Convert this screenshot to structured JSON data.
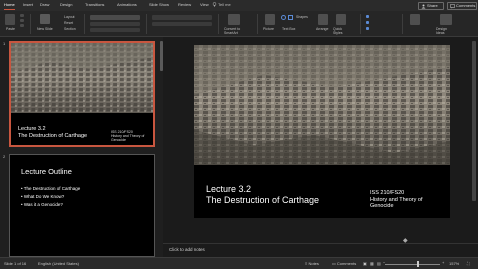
{
  "ribbon_tabs": [
    "Home",
    "Insert",
    "Draw",
    "Design",
    "Transitions",
    "Animations",
    "Slide Show",
    "Review",
    "View"
  ],
  "tell_me": "Tell me",
  "share_label": "Share",
  "comments_label": "Comments",
  "ribbon": {
    "paste": "Paste",
    "new_slide": "New Slide",
    "layout": "Layout",
    "reset": "Reset",
    "section": "Section",
    "convert_to_smartart": "Convert to SmartArt",
    "picture": "Picture",
    "shapes": "Shapes",
    "text_box": "Text Box",
    "arrange": "Arrange",
    "quick_styles": "Quick Styles",
    "design_ideas": "Design Ideas"
  },
  "slides": [
    {
      "number": "1",
      "title_line1": "Lecture 3.2",
      "title_line2": "The Destruction of Carthage",
      "course_line1": "ISS 210/FS20",
      "course_line2": "History and Theory of",
      "course_line3": "Genocide"
    },
    {
      "number": "2",
      "title": "Lecture Outline",
      "bullets": [
        "The Destruction of Carthage",
        "What Do We Know?",
        "Was it a Genocide?"
      ]
    }
  ],
  "main_slide": {
    "title_line1": "Lecture 3.2",
    "title_line2": "The Destruction of Carthage",
    "course_line1": "ISS 210/FS20",
    "course_line2": "History and Theory of",
    "course_line3": "Genocide"
  },
  "notes_placeholder": "Click to add notes",
  "status": {
    "slide_of": "Slide 1 of 16",
    "language": "English (United States)",
    "notes": "Notes",
    "comments": "Comments",
    "zoom": "157%"
  },
  "colors": {
    "accent": "#c8563f",
    "background": "#1f1f1f"
  }
}
